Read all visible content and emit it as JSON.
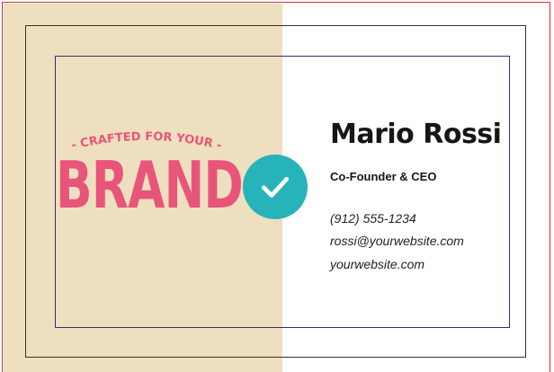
{
  "card": {
    "tagline": "- CRAFTED FOR YOUR -",
    "brand": "BRAND",
    "name": "Mario Rossi",
    "title": "Co-Founder & CEO",
    "phone": "(912) 555-1234",
    "email": "rossi@yourwebsite.com",
    "website": "yourwebsite.com"
  },
  "status": {
    "icon": "checkmark-icon"
  },
  "colors": {
    "brand_pink": "#e8557a",
    "panel_tan": "#eedfc0",
    "badge_teal": "#26b3ba",
    "frame_red": "#d32f2f"
  }
}
